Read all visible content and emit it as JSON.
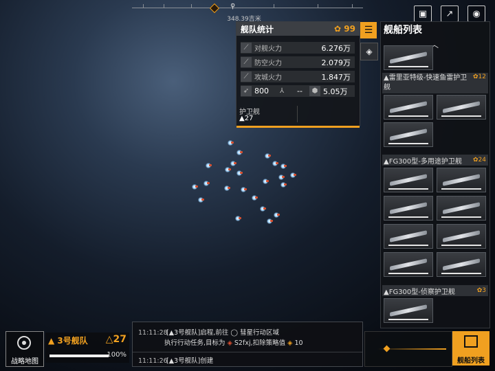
{
  "ruler": {
    "distance": "348.39吉米"
  },
  "top_buttons": {
    "screen_icon": "screen-icon",
    "share_icon": "share-icon",
    "eye_icon": "eye-icon"
  },
  "fleet_stats": {
    "title": "舰队统计",
    "ship_count": "99",
    "rows": [
      {
        "label": "对舰火力",
        "value": "6.276万"
      },
      {
        "label": "防空火力",
        "value": "2.079万"
      },
      {
        "label": "攻城火力",
        "value": "1.847万"
      }
    ],
    "misc": {
      "speed": "800",
      "cargo": "--",
      "hp": "5.05万"
    },
    "escort_label": "护卫舰",
    "escort_count": "▲27"
  },
  "ship_list": {
    "title": "舰船列表",
    "groups": [
      {
        "name": "▲雷里亚特级-快速鱼雷护卫舰",
        "count": "12"
      },
      {
        "name": "▲FG300型-多用途护卫舰",
        "count": "24"
      },
      {
        "name": "▲FG300型-侦察护卫舰",
        "count": "3"
      }
    ]
  },
  "map_button": {
    "label": "战略地图"
  },
  "fleet_card": {
    "name": "3号舰队",
    "power": "27",
    "progress_pct": 100,
    "progress_label": "100%"
  },
  "log": {
    "entry1_time": "11:11:28",
    "entry1_text_a": "[▲3号舰队]启程,前往",
    "entry1_text_b": "彗星行动区域",
    "entry1_line2_a": "执行行动任务,目标为",
    "entry1_line2_b": "S2fxj,扣除策略值",
    "entry1_line2_c": "10",
    "entry2_time": "11:11:26",
    "entry2_text": "[▲3号舰队]创建"
  },
  "ship_list_button": {
    "label": "舰船列表"
  },
  "colors": {
    "accent": "#f0a020",
    "alert": "#e05030"
  }
}
